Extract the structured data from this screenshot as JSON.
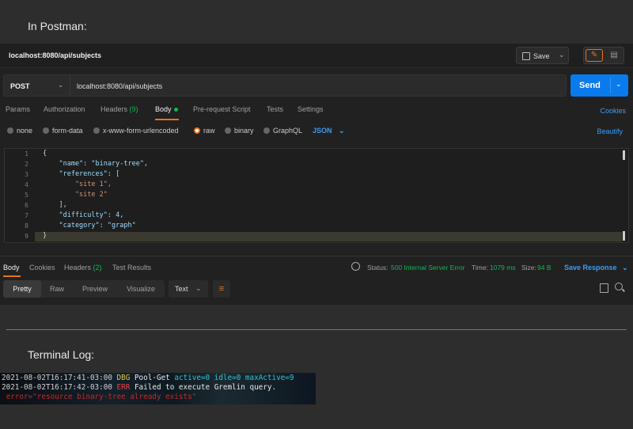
{
  "headings": {
    "postman": "In Postman:",
    "terminal": "Terminal Log:"
  },
  "request_tab": {
    "title": "localhost:8080/api/subjects",
    "save_label": "Save"
  },
  "request": {
    "method": "POST",
    "url": "localhost:8080/api/subjects",
    "send_label": "Send"
  },
  "tabs": [
    {
      "label": "Params"
    },
    {
      "label": "Authorization"
    },
    {
      "label": "Headers",
      "count": "(9)"
    },
    {
      "label": "Body"
    },
    {
      "label": "Pre-request Script"
    },
    {
      "label": "Tests"
    },
    {
      "label": "Settings"
    }
  ],
  "cookies_label": "Cookies",
  "body_types": [
    "none",
    "form-data",
    "x-www-form-urlencoded",
    "raw",
    "binary",
    "GraphQL"
  ],
  "body_format": "JSON",
  "beautify_label": "Beautify",
  "code_lines": [
    "{",
    "    \"name\": \"binary-tree\",",
    "    \"references\": [",
    "        \"site 1\",",
    "        \"site 2\"",
    "    ],",
    "    \"difficulty\": 4,",
    "    \"category\": \"graph\"",
    "}"
  ],
  "response": {
    "tabs": [
      {
        "label": "Body"
      },
      {
        "label": "Cookies"
      },
      {
        "label": "Headers",
        "count": "(2)"
      },
      {
        "label": "Test Results"
      }
    ],
    "status_label": "Status:",
    "status_value": "500 Internal Server Error",
    "time_label": "Time:",
    "time_value": "1079 ms",
    "size_label": "Size:",
    "size_value": "94 B",
    "save_response": "Save Response",
    "views": [
      "Pretty",
      "Raw",
      "Preview",
      "Visualize"
    ],
    "format": "Text"
  },
  "terminal": {
    "line1": {
      "ts": "2021-08-02T16:17:41-03:00",
      "level": "DBG",
      "msg": "Pool-Get",
      "kv": "active=0 idle=0 maxActive=9"
    },
    "line2": {
      "ts": "2021-08-02T16:17:42-03:00",
      "level": "ERR",
      "msg": "Failed to execute Gremlin query."
    },
    "line3": {
      "text": " error=\"resource binary-tree already exists\""
    }
  },
  "colors": {
    "accent": "#e8731f",
    "primary": "#097bed",
    "link": "#3d9bf5",
    "success": "#0cbb52"
  }
}
